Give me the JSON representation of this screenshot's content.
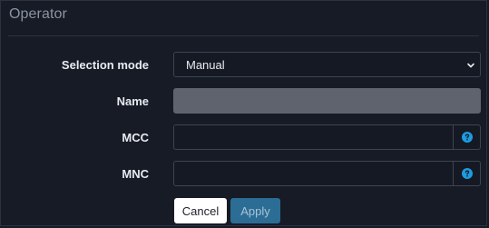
{
  "panel": {
    "title": "Operator"
  },
  "form": {
    "selection_mode": {
      "label": "Selection mode",
      "value": "Manual"
    },
    "name": {
      "label": "Name",
      "value": ""
    },
    "mcc": {
      "label": "MCC",
      "value": "",
      "help_icon": "question-circle-icon"
    },
    "mnc": {
      "label": "MNC",
      "value": "",
      "help_icon": "question-circle-icon"
    }
  },
  "buttons": {
    "cancel": "Cancel",
    "apply": "Apply"
  },
  "colors": {
    "background": "#171b25",
    "accent": "#2b6d94",
    "help_icon": "#1e9be0"
  }
}
